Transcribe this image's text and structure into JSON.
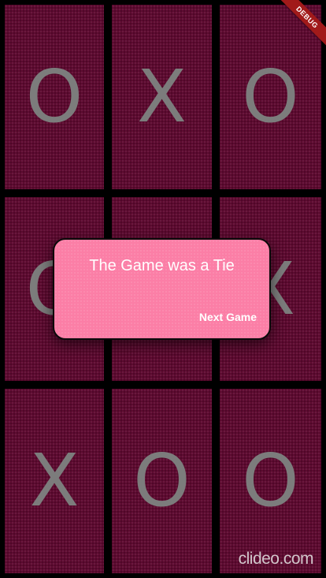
{
  "board": {
    "cells": [
      [
        "O",
        "X",
        "O"
      ],
      [
        "O",
        "",
        "X"
      ],
      [
        "X",
        "O",
        "O"
      ]
    ]
  },
  "debug_banner": "DEBUG",
  "dialog": {
    "title": "The Game was a Tie",
    "next_button": "Next Game"
  },
  "watermark": "clideo.com",
  "colors": {
    "cell_background": "#5e0a30",
    "grid_lines": "#000000",
    "mark": "#7c7c7c",
    "dialog_background": "#fb7ea6",
    "debug_ribbon": "#a11a1a"
  }
}
